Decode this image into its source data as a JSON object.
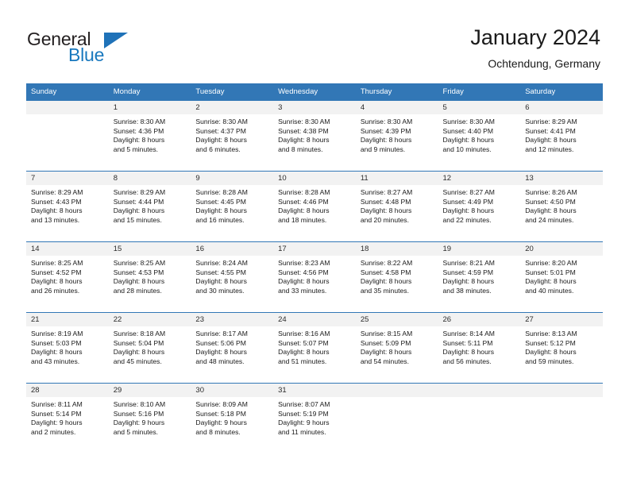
{
  "brand": {
    "name_dark": "General",
    "name_light": "Blue",
    "accent_color": "#1878be"
  },
  "header": {
    "title": "January 2024",
    "location": "Ochtendung, Germany"
  },
  "theme": {
    "header_bg": "#3277b6",
    "daynum_bg": "#f2f2f2",
    "text_color": "#1a1a1a"
  },
  "columns": [
    "Sunday",
    "Monday",
    "Tuesday",
    "Wednesday",
    "Thursday",
    "Friday",
    "Saturday"
  ],
  "weeks": [
    [
      {
        "day": "",
        "lines": []
      },
      {
        "day": "1",
        "lines": [
          "Sunrise: 8:30 AM",
          "Sunset: 4:36 PM",
          "Daylight: 8 hours",
          "and 5 minutes."
        ]
      },
      {
        "day": "2",
        "lines": [
          "Sunrise: 8:30 AM",
          "Sunset: 4:37 PM",
          "Daylight: 8 hours",
          "and 6 minutes."
        ]
      },
      {
        "day": "3",
        "lines": [
          "Sunrise: 8:30 AM",
          "Sunset: 4:38 PM",
          "Daylight: 8 hours",
          "and 8 minutes."
        ]
      },
      {
        "day": "4",
        "lines": [
          "Sunrise: 8:30 AM",
          "Sunset: 4:39 PM",
          "Daylight: 8 hours",
          "and 9 minutes."
        ]
      },
      {
        "day": "5",
        "lines": [
          "Sunrise: 8:30 AM",
          "Sunset: 4:40 PM",
          "Daylight: 8 hours",
          "and 10 minutes."
        ]
      },
      {
        "day": "6",
        "lines": [
          "Sunrise: 8:29 AM",
          "Sunset: 4:41 PM",
          "Daylight: 8 hours",
          "and 12 minutes."
        ]
      }
    ],
    [
      {
        "day": "7",
        "lines": [
          "Sunrise: 8:29 AM",
          "Sunset: 4:43 PM",
          "Daylight: 8 hours",
          "and 13 minutes."
        ]
      },
      {
        "day": "8",
        "lines": [
          "Sunrise: 8:29 AM",
          "Sunset: 4:44 PM",
          "Daylight: 8 hours",
          "and 15 minutes."
        ]
      },
      {
        "day": "9",
        "lines": [
          "Sunrise: 8:28 AM",
          "Sunset: 4:45 PM",
          "Daylight: 8 hours",
          "and 16 minutes."
        ]
      },
      {
        "day": "10",
        "lines": [
          "Sunrise: 8:28 AM",
          "Sunset: 4:46 PM",
          "Daylight: 8 hours",
          "and 18 minutes."
        ]
      },
      {
        "day": "11",
        "lines": [
          "Sunrise: 8:27 AM",
          "Sunset: 4:48 PM",
          "Daylight: 8 hours",
          "and 20 minutes."
        ]
      },
      {
        "day": "12",
        "lines": [
          "Sunrise: 8:27 AM",
          "Sunset: 4:49 PM",
          "Daylight: 8 hours",
          "and 22 minutes."
        ]
      },
      {
        "day": "13",
        "lines": [
          "Sunrise: 8:26 AM",
          "Sunset: 4:50 PM",
          "Daylight: 8 hours",
          "and 24 minutes."
        ]
      }
    ],
    [
      {
        "day": "14",
        "lines": [
          "Sunrise: 8:25 AM",
          "Sunset: 4:52 PM",
          "Daylight: 8 hours",
          "and 26 minutes."
        ]
      },
      {
        "day": "15",
        "lines": [
          "Sunrise: 8:25 AM",
          "Sunset: 4:53 PM",
          "Daylight: 8 hours",
          "and 28 minutes."
        ]
      },
      {
        "day": "16",
        "lines": [
          "Sunrise: 8:24 AM",
          "Sunset: 4:55 PM",
          "Daylight: 8 hours",
          "and 30 minutes."
        ]
      },
      {
        "day": "17",
        "lines": [
          "Sunrise: 8:23 AM",
          "Sunset: 4:56 PM",
          "Daylight: 8 hours",
          "and 33 minutes."
        ]
      },
      {
        "day": "18",
        "lines": [
          "Sunrise: 8:22 AM",
          "Sunset: 4:58 PM",
          "Daylight: 8 hours",
          "and 35 minutes."
        ]
      },
      {
        "day": "19",
        "lines": [
          "Sunrise: 8:21 AM",
          "Sunset: 4:59 PM",
          "Daylight: 8 hours",
          "and 38 minutes."
        ]
      },
      {
        "day": "20",
        "lines": [
          "Sunrise: 8:20 AM",
          "Sunset: 5:01 PM",
          "Daylight: 8 hours",
          "and 40 minutes."
        ]
      }
    ],
    [
      {
        "day": "21",
        "lines": [
          "Sunrise: 8:19 AM",
          "Sunset: 5:03 PM",
          "Daylight: 8 hours",
          "and 43 minutes."
        ]
      },
      {
        "day": "22",
        "lines": [
          "Sunrise: 8:18 AM",
          "Sunset: 5:04 PM",
          "Daylight: 8 hours",
          "and 45 minutes."
        ]
      },
      {
        "day": "23",
        "lines": [
          "Sunrise: 8:17 AM",
          "Sunset: 5:06 PM",
          "Daylight: 8 hours",
          "and 48 minutes."
        ]
      },
      {
        "day": "24",
        "lines": [
          "Sunrise: 8:16 AM",
          "Sunset: 5:07 PM",
          "Daylight: 8 hours",
          "and 51 minutes."
        ]
      },
      {
        "day": "25",
        "lines": [
          "Sunrise: 8:15 AM",
          "Sunset: 5:09 PM",
          "Daylight: 8 hours",
          "and 54 minutes."
        ]
      },
      {
        "day": "26",
        "lines": [
          "Sunrise: 8:14 AM",
          "Sunset: 5:11 PM",
          "Daylight: 8 hours",
          "and 56 minutes."
        ]
      },
      {
        "day": "27",
        "lines": [
          "Sunrise: 8:13 AM",
          "Sunset: 5:12 PM",
          "Daylight: 8 hours",
          "and 59 minutes."
        ]
      }
    ],
    [
      {
        "day": "28",
        "lines": [
          "Sunrise: 8:11 AM",
          "Sunset: 5:14 PM",
          "Daylight: 9 hours",
          "and 2 minutes."
        ]
      },
      {
        "day": "29",
        "lines": [
          "Sunrise: 8:10 AM",
          "Sunset: 5:16 PM",
          "Daylight: 9 hours",
          "and 5 minutes."
        ]
      },
      {
        "day": "30",
        "lines": [
          "Sunrise: 8:09 AM",
          "Sunset: 5:18 PM",
          "Daylight: 9 hours",
          "and 8 minutes."
        ]
      },
      {
        "day": "31",
        "lines": [
          "Sunrise: 8:07 AM",
          "Sunset: 5:19 PM",
          "Daylight: 9 hours",
          "and 11 minutes."
        ]
      },
      {
        "day": "",
        "lines": []
      },
      {
        "day": "",
        "lines": []
      },
      {
        "day": "",
        "lines": []
      }
    ]
  ]
}
